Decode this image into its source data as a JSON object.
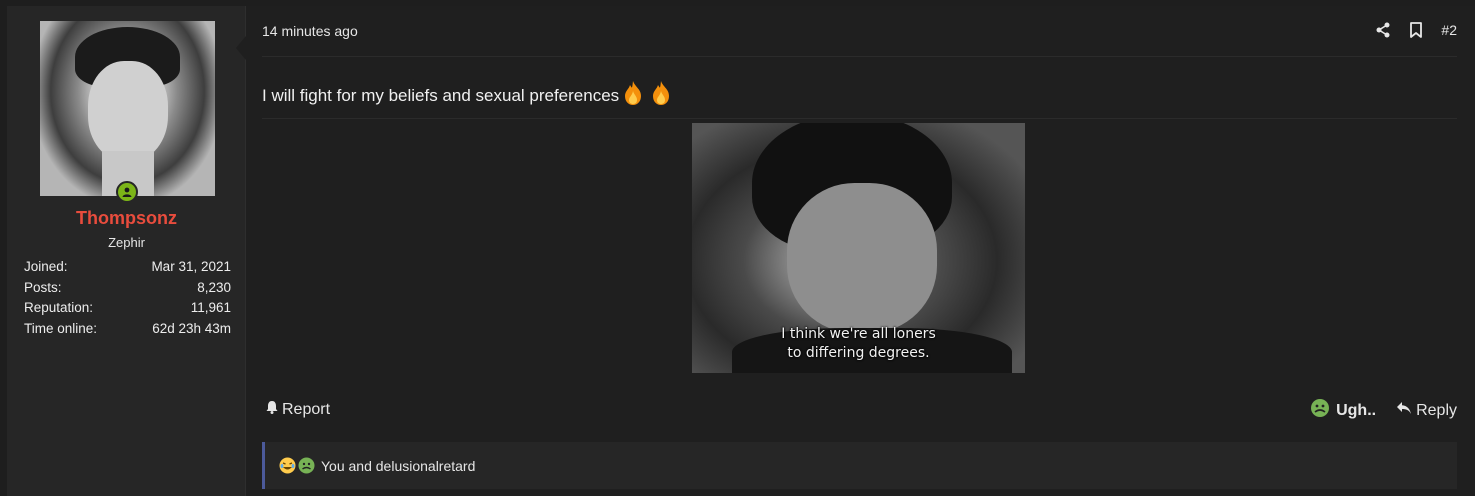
{
  "user": {
    "name": "Thompsonz",
    "title": "Zephir",
    "stats": [
      {
        "label": "Joined:",
        "value": "Mar 31, 2021"
      },
      {
        "label": "Posts:",
        "value": "8,230"
      },
      {
        "label": "Reputation:",
        "value": "11,961"
      },
      {
        "label": "Time online:",
        "value": "62d 23h 43m"
      }
    ]
  },
  "post": {
    "time": "14 minutes ago",
    "number": "#2",
    "message": "I will fight for my beliefs and sexual preferences",
    "gif_subtitle_line1": "I think we're all loners",
    "gif_subtitle_line2": "to differing degrees."
  },
  "actions": {
    "report": "Report",
    "reaction": "Ugh..",
    "reply": "Reply"
  },
  "reactions_bar": {
    "text": "You and delusionalretard"
  },
  "colors": {
    "username": "#e84c3d",
    "online": "#7cb518",
    "reaction_accent": "#4c5a9a"
  },
  "icons": {
    "share": "share-icon",
    "bookmark": "bookmark-icon",
    "bell": "bell-icon",
    "reply": "reply-icon",
    "fire": "fire-emoji-icon",
    "sick": "sick-face-icon",
    "laugh": "laughing-face-icon"
  }
}
